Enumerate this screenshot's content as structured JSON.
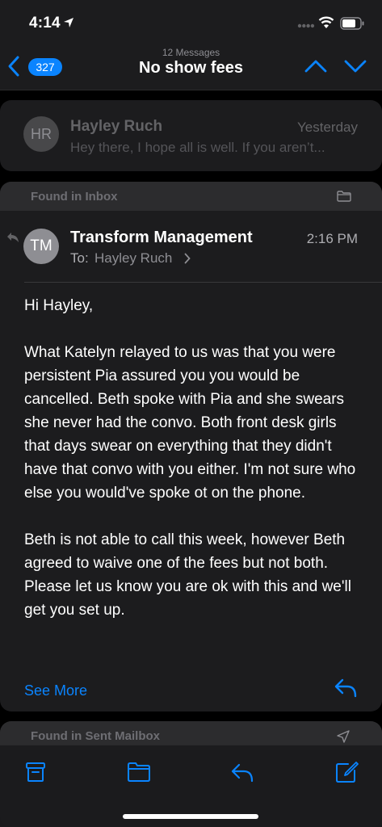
{
  "status_bar": {
    "time": "4:14"
  },
  "nav": {
    "badge_count": "327",
    "message_count": "12 Messages",
    "title": "No show fees"
  },
  "previous_message": {
    "initials": "HR",
    "sender": "Hayley Ruch",
    "date": "Yesterday",
    "snippet": "Hey there, I hope all is well. If you aren’t..."
  },
  "main_message": {
    "found_in": "Found in Inbox",
    "initials": "TM",
    "sender": "Transform Management",
    "time": "2:16 PM",
    "to_label": "To:",
    "to_name": "Hayley Ruch",
    "body": [
      "Hi Hayley,",
      "What Katelyn relayed to us was that you were persistent Pia assured you you would be cancelled. Beth spoke with Pia and she swears she never had the convo. Both front desk girls that days swear on everything that they didn't have that convo with you either. I'm not sure who else you would've spoke ot on the phone.",
      "Beth is not able to call this week, however Beth agreed to waive one of the fees but not both.  Please  let us know you are ok with this and we'll get you set up."
    ],
    "see_more": "See More"
  },
  "next_message": {
    "found_in": "Found in Sent Mailbox"
  },
  "toolbar": {
    "icons": [
      "archive-icon",
      "folder-icon",
      "reply-icon",
      "compose-icon"
    ]
  },
  "colors": {
    "accent": "#0a84ff",
    "background": "#000000",
    "card": "#1c1c1e"
  }
}
